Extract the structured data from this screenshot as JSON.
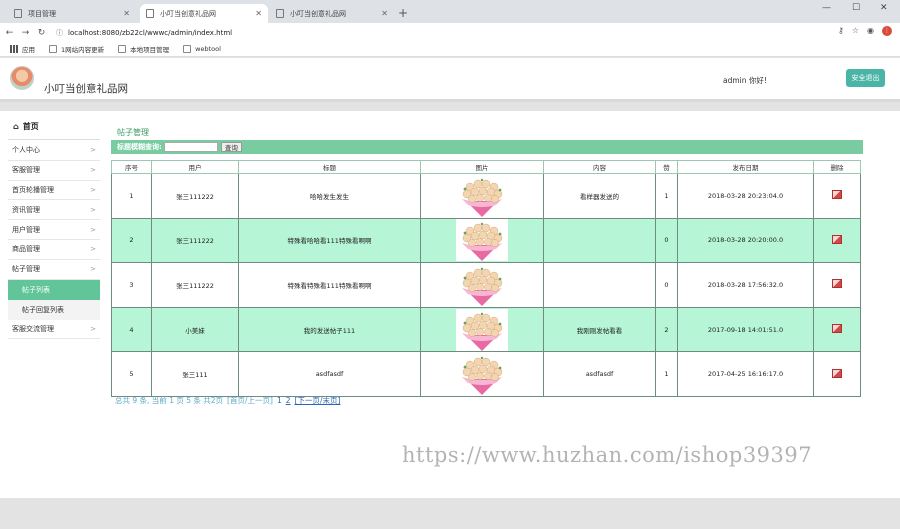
{
  "browser": {
    "tabs": [
      {
        "title": "项目管理",
        "active": false
      },
      {
        "title": "小叮当创意礼品网",
        "active": true
      },
      {
        "title": "小叮当创意礼品网",
        "active": false
      }
    ],
    "new_tab": "+",
    "url": "localhost:8080/zb22cl/wwwc/admin/index.html",
    "bookmarks": [
      "应用",
      "1网站内容更新",
      "本地项目管理",
      "webtool"
    ]
  },
  "header": {
    "site_title": "小叮当创意礼品网",
    "welcome": "admin 你好!",
    "logout_label": "安全退出"
  },
  "sidebar": {
    "home_label": "首页",
    "items": [
      {
        "label": "个人中心",
        "arrow": ">"
      },
      {
        "label": "客服管理",
        "arrow": ">"
      },
      {
        "label": "首页轮播管理",
        "arrow": ">"
      },
      {
        "label": "资讯管理",
        "arrow": ">"
      },
      {
        "label": "用户管理",
        "arrow": ">"
      },
      {
        "label": "商品管理",
        "arrow": ">"
      },
      {
        "label": "帖子管理",
        "arrow": ">"
      }
    ],
    "sub_items": [
      {
        "label": "帖子列表",
        "active": true
      },
      {
        "label": "帖子回复列表",
        "active": false
      }
    ],
    "last_item": {
      "label": "客服交流管理",
      "arrow": ">"
    }
  },
  "main": {
    "heading": "帖子管理",
    "search_label": "标题模糊查询:",
    "search_value": "",
    "search_button": "查询",
    "columns": [
      "序号",
      "用户",
      "标题",
      "图片",
      "内容",
      "赞",
      "发布日期",
      "删除"
    ],
    "rows": [
      {
        "id": "1",
        "user": "张三111222",
        "title": "哈哈发生发生",
        "content": "看样器发送的",
        "likes": "1",
        "date": "2018-03-28 20:23:04.0"
      },
      {
        "id": "2",
        "user": "张三111222",
        "title": "特殊看哈哈看111特殊看啊啊",
        "content": "",
        "likes": "0",
        "date": "2018-03-28 20:20:00.0"
      },
      {
        "id": "3",
        "user": "张三111222",
        "title": "特殊看特殊看111特殊看啊啊",
        "content": "",
        "likes": "0",
        "date": "2018-03-28 17:56:32.0"
      },
      {
        "id": "4",
        "user": "小美妹",
        "title": "我的发送帖子111",
        "content": "我刚刚发帖看看",
        "likes": "2",
        "date": "2017-09-18 14:01:51.0"
      },
      {
        "id": "5",
        "user": "张三111",
        "title": "asdfasdf",
        "content": "asdfasdf",
        "likes": "1",
        "date": "2017-04-25 16:16:17.0"
      }
    ],
    "pager": {
      "summary": "总共 9 条,  当前 1 页 5 条 共2页",
      "first_prev": "[首页/上一页]",
      "page_1": "1",
      "page_2": "2",
      "next": "[下一页",
      "last": "/末页]"
    }
  },
  "watermark": "https://www.huzhan.com/ishop39397",
  "colors": {
    "accent_green": "#79cca0",
    "row_highlight": "#b6f5d5",
    "logout_teal": "#4ab5a6"
  }
}
